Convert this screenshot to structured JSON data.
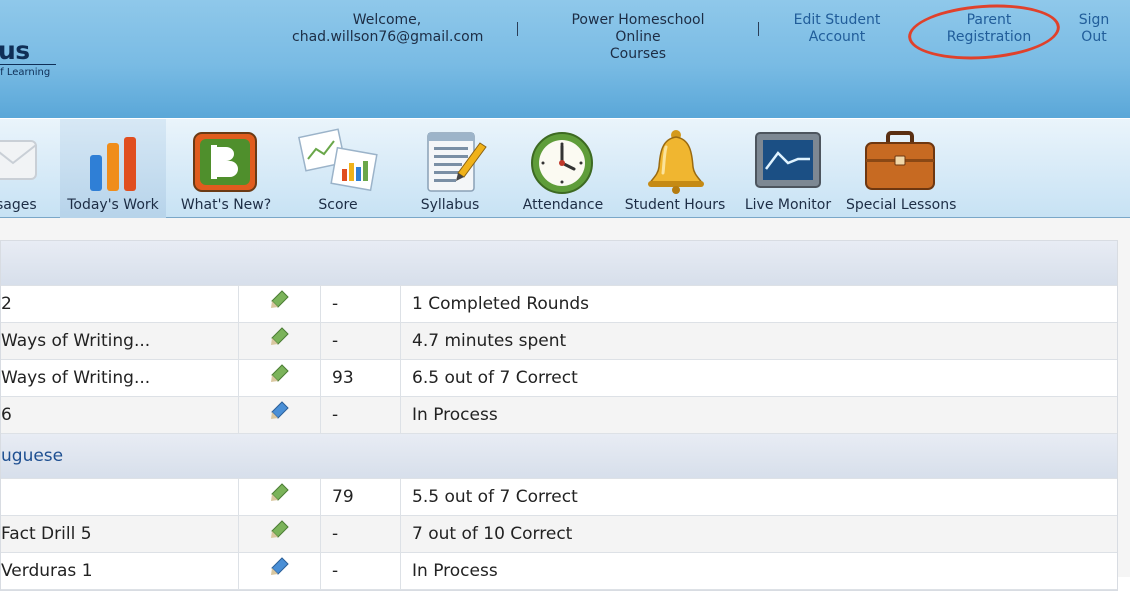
{
  "logo": {
    "name": "us",
    "tagline": "of Learning"
  },
  "header": {
    "welcome_line1": "Welcome,",
    "welcome_line2": "chad.willson76@gmail.com",
    "courses_line1": "Power Homeschool Online",
    "courses_line2": "Courses",
    "edit_line1": "Edit Student",
    "edit_line2": "Account",
    "parent_line1": "Parent",
    "parent_line2": "Registration",
    "signout_line1": "Sign",
    "signout_line2": "Out"
  },
  "toolbar": {
    "items": [
      {
        "label": "sages",
        "icon": "envelope-icon"
      },
      {
        "label": "Today's Work",
        "icon": "bar-chart-icon"
      },
      {
        "label": "What's New?",
        "icon": "blog-icon"
      },
      {
        "label": "Score",
        "icon": "score-charts-icon"
      },
      {
        "label": "Syllabus",
        "icon": "syllabus-icon"
      },
      {
        "label": "Attendance",
        "icon": "clock-icon"
      },
      {
        "label": "Student Hours",
        "icon": "bell-icon"
      },
      {
        "label": "Live Monitor",
        "icon": "monitor-icon"
      },
      {
        "label": "Special Lessons",
        "icon": "briefcase-icon"
      }
    ]
  },
  "table": {
    "section1": "",
    "section2": "uguese",
    "rows1": [
      {
        "title": "2",
        "score": "-",
        "status": "1 Completed Rounds",
        "pen": "green"
      },
      {
        "title": " Ways of Writing...",
        "score": "-",
        "status": "4.7 minutes spent",
        "pen": "green"
      },
      {
        "title": " Ways of Writing...",
        "score": "93",
        "status": "6.5 out of 7 Correct",
        "pen": "green"
      },
      {
        "title": "6",
        "score": "-",
        "status": "In Process",
        "pen": "blue"
      }
    ],
    "rows2": [
      {
        "title": "",
        "score": "79",
        "status": "5.5 out of 7 Correct",
        "pen": "green"
      },
      {
        "title": " Fact Drill 5",
        "score": "-",
        "status": "7 out of 10 Correct",
        "pen": "green"
      },
      {
        "title": "Verduras 1",
        "score": "-",
        "status": "In Process",
        "pen": "blue"
      }
    ]
  },
  "colors": {
    "header": "#79bbe4",
    "link": "#215d9a",
    "annotation": "#e0412b",
    "pen_green": "#7bb35a",
    "pen_blue": "#4a8fd6"
  }
}
